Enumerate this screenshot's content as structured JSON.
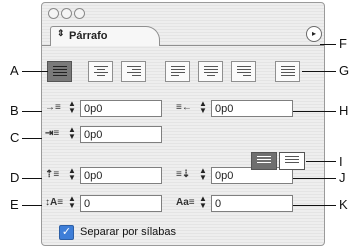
{
  "panel": {
    "tab_label": "Párrafo",
    "tab_arrows": "⇕",
    "menu_icon": "▸"
  },
  "callouts": {
    "A": "A",
    "B": "B",
    "C": "C",
    "D": "D",
    "E": "E",
    "F": "F",
    "G": "G",
    "H": "H",
    "I": "I",
    "J": "J",
    "K": "K"
  },
  "fields": {
    "left_indent": "0p0",
    "right_indent": "0p0",
    "first_line_indent": "0p0",
    "space_before": "0p0",
    "space_after": "0p0",
    "drop_cap_lines": "0",
    "drop_cap_chars": "0"
  },
  "hyphenate": {
    "label": "Separar por sílabas",
    "checked": true
  }
}
